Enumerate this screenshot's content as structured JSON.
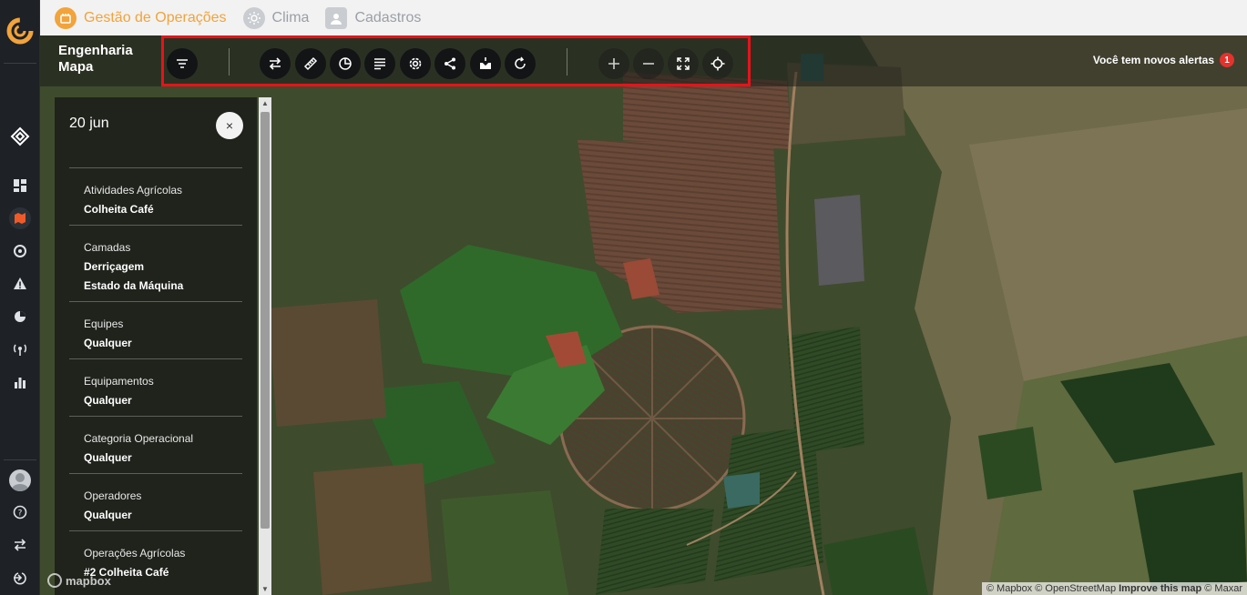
{
  "nav_tabs": [
    {
      "label": "Gestão de Operações",
      "icon": "operations-icon",
      "active": true
    },
    {
      "label": "Clima",
      "icon": "sun-icon",
      "active": false
    },
    {
      "label": "Cadastros",
      "icon": "user-icon",
      "active": false
    }
  ],
  "map_header": {
    "title_line1": "Engenharia",
    "title_line2": "Mapa",
    "alerts_text": "Você tem novos alertas",
    "alerts_count": "1"
  },
  "toolbar": {
    "buttons": [
      "filter-icon",
      "swap-icon",
      "ruler-icon",
      "pie-chart-icon",
      "list-icon",
      "settings-icon",
      "share-icon",
      "download-icon",
      "refresh-icon",
      "zoom-in-icon",
      "zoom-out-icon",
      "fullscreen-icon",
      "locate-icon"
    ]
  },
  "filter_panel": {
    "date": "20 jun",
    "close_label": "×",
    "sections": [
      {
        "label": "Atividades Agrícolas",
        "values": [
          "Colheita Café"
        ]
      },
      {
        "label": "Camadas",
        "values": [
          "Derriçagem",
          "Estado da Máquina"
        ]
      },
      {
        "label": "Equipes",
        "values": [
          "Qualquer"
        ]
      },
      {
        "label": "Equipamentos",
        "values": [
          "Qualquer"
        ]
      },
      {
        "label": "Categoria Operacional",
        "values": [
          "Qualquer"
        ]
      },
      {
        "label": "Operadores",
        "values": [
          "Qualquer"
        ]
      },
      {
        "label": "Operações Agrícolas",
        "values": [
          "#2 Colheita Café"
        ]
      }
    ]
  },
  "map_footer": {
    "mapbox_logo": "mapbox",
    "attribution_1": "© Mapbox © OpenStreetMap",
    "attribution_2": "Improve this map",
    "attribution_3": "© Maxar"
  },
  "colors": {
    "accent": "#f2a33a",
    "highlight_frame": "#e8121a",
    "alert_badge": "#e5322d"
  },
  "rail_icons": [
    "dashboard-icon",
    "map-layers-icon",
    "radar-icon",
    "alert-triangle-icon",
    "pie-chart-icon",
    "antenna-icon",
    "bar-chart-icon",
    "help-icon",
    "swap-icon",
    "logout-icon"
  ]
}
